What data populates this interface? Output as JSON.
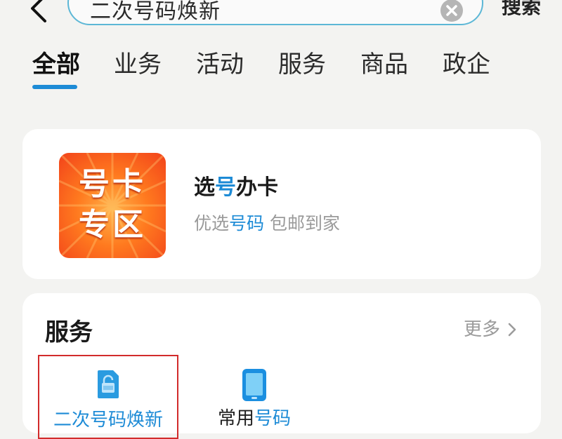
{
  "search": {
    "value": "二次号码焕新",
    "button_label": "搜索"
  },
  "tabs": [
    {
      "label": "全部",
      "active": true
    },
    {
      "label": "业务",
      "active": false
    },
    {
      "label": "活动",
      "active": false
    },
    {
      "label": "服务",
      "active": false
    },
    {
      "label": "商品",
      "active": false
    },
    {
      "label": "政企",
      "active": false
    }
  ],
  "promo_card": {
    "banner_line1": "号卡",
    "banner_line2": "专区",
    "title_pre": "选",
    "title_highlight": "号",
    "title_post": "办卡",
    "subtitle_pre": "优选",
    "subtitle_highlight": "号码",
    "subtitle_post": " 包邮到家"
  },
  "services": {
    "heading": "服务",
    "more_label": "更多",
    "items": [
      {
        "label": "二次号码焕新",
        "icon": "unlock-sim-icon"
      },
      {
        "label_pre": "常用",
        "label_highlight": "号码",
        "icon": "phone-icon"
      }
    ]
  },
  "colors": {
    "accent": "#1d8bd6",
    "highlight_border": "#d22b2b",
    "background": "#f3f3f1"
  }
}
